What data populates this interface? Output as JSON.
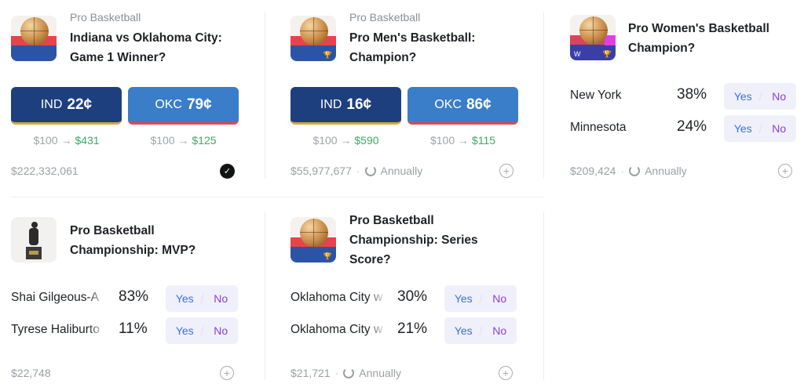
{
  "cards": [
    {
      "category": "Pro Basketball",
      "title": "Indiana vs Oklahoma City: Game 1 Winner?",
      "buttons": [
        {
          "team": "IND",
          "price": "22¢",
          "stake": "$100",
          "payout": "$431"
        },
        {
          "team": "OKC",
          "price": "79¢",
          "stake": "$100",
          "payout": "$125"
        }
      ],
      "volume": "$222,332,061",
      "recurrence": ""
    },
    {
      "category": "Pro Basketball",
      "title": "Pro Men's Basketball: Champion?",
      "buttons": [
        {
          "team": "IND",
          "price": "16¢",
          "stake": "$100",
          "payout": "$590"
        },
        {
          "team": "OKC",
          "price": "86¢",
          "stake": "$100",
          "payout": "$115"
        }
      ],
      "volume": "$55,977,677",
      "recurrence": "Annually"
    },
    {
      "category": "",
      "title": "Pro Women's Basketball Champion?",
      "thumb_label": "W",
      "rows": [
        {
          "name": "New York",
          "pct": "38%",
          "yes": "Yes",
          "no": "No"
        },
        {
          "name": "Minnesota",
          "pct": "24%",
          "yes": "Yes",
          "no": "No"
        }
      ],
      "volume": "$209,424",
      "recurrence": "Annually"
    },
    {
      "category": "",
      "title": "Pro Basketball Championship: MVP?",
      "rows": [
        {
          "name": "Shai Gilgeous-A",
          "pct": "83%",
          "yes": "Yes",
          "no": "No"
        },
        {
          "name": "Tyrese Haliburto",
          "pct": "11%",
          "yes": "Yes",
          "no": "No"
        }
      ],
      "volume": "$22,748",
      "recurrence": ""
    },
    {
      "category": "",
      "title": "Pro Basketball Championship: Series Score?",
      "rows": [
        {
          "name": "Oklahoma City w",
          "pct": "30%",
          "yes": "Yes",
          "no": "No"
        },
        {
          "name": "Oklahoma City w",
          "pct": "21%",
          "yes": "Yes",
          "no": "No"
        }
      ],
      "volume": "$21,721",
      "recurrence": "Annually"
    }
  ],
  "colors": {
    "dark_button": "#1d3f7d",
    "light_button": "#3a7dc9",
    "win": "#3fa869",
    "yes": "#3b72d9",
    "no": "#8b3fd1"
  },
  "icons": [
    "basketball-icon",
    "trophy-icon",
    "recurring-icon",
    "plus-circle-icon",
    "checkmark-icon",
    "mvp-statue-icon"
  ]
}
